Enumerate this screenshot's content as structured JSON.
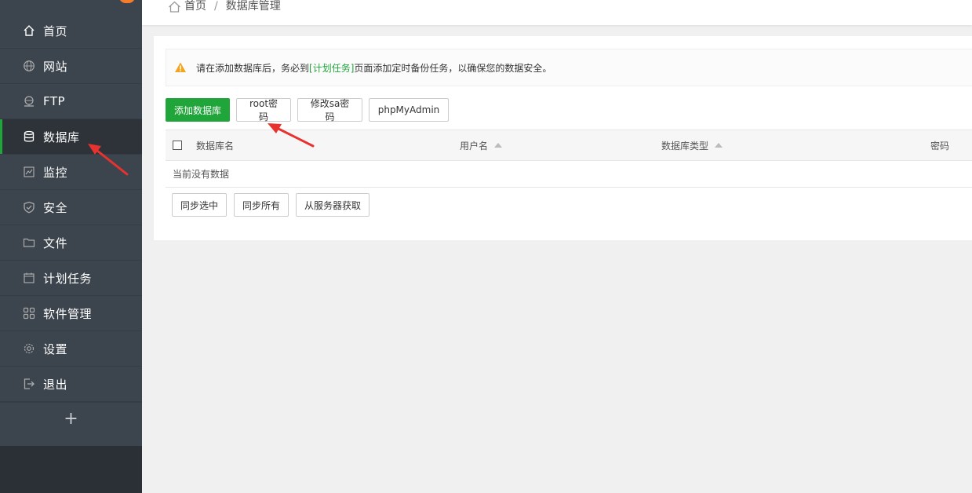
{
  "sidebar": {
    "items": [
      {
        "label": "首页",
        "icon": "home-icon",
        "active": false
      },
      {
        "label": "网站",
        "icon": "globe-icon",
        "active": false
      },
      {
        "label": "FTP",
        "icon": "ftp-icon",
        "active": false
      },
      {
        "label": "数据库",
        "icon": "database-icon",
        "active": true
      },
      {
        "label": "监控",
        "icon": "monitor-icon",
        "active": false
      },
      {
        "label": "安全",
        "icon": "shield-icon",
        "active": false
      },
      {
        "label": "文件",
        "icon": "folder-icon",
        "active": false
      },
      {
        "label": "计划任务",
        "icon": "calendar-icon",
        "active": false
      },
      {
        "label": "软件管理",
        "icon": "grid-icon",
        "active": false
      },
      {
        "label": "设置",
        "icon": "gear-icon",
        "active": false
      },
      {
        "label": "退出",
        "icon": "logout-icon",
        "active": false
      }
    ],
    "add_label": "+"
  },
  "breadcrumb": {
    "home": "首页",
    "separator": "/",
    "current": "数据库管理"
  },
  "alert": {
    "prefix": "请在添加数据库后，务必到",
    "link": "[计划任务]",
    "suffix": "页面添加定时备份任务，以确保您的数据安全。"
  },
  "toolbar": {
    "add_db": "添加数据库",
    "root_password": "root密码",
    "sa_password": "修改sa密码",
    "phpmyadmin": "phpMyAdmin"
  },
  "table": {
    "columns": [
      "数据库名",
      "用户名",
      "数据库类型",
      "密码"
    ],
    "empty_text": "当前没有数据"
  },
  "sync": {
    "selected": "同步选中",
    "all": "同步所有",
    "from_server": "从服务器获取"
  },
  "colors": {
    "accent": "#20a53a",
    "sidebar_bg": "#3c444d",
    "annotation_red": "#e8322f"
  }
}
